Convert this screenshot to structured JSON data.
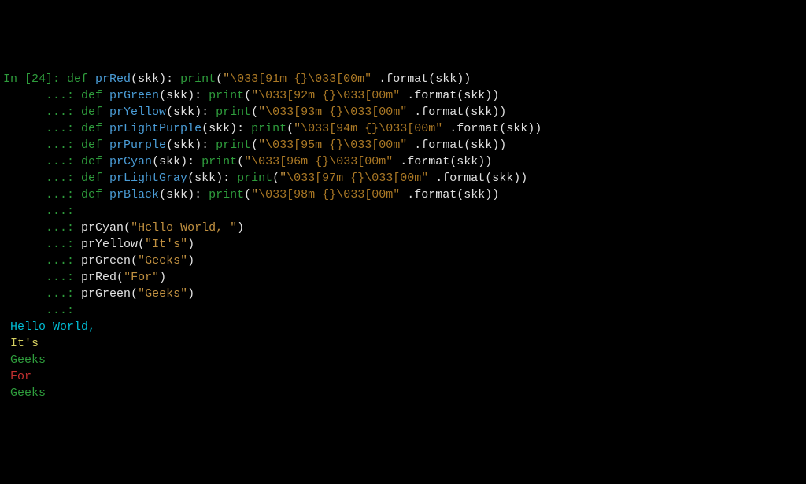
{
  "prompt": {
    "in": "In [24]:",
    "cont": "   ...:"
  },
  "defs": [
    {
      "fn": "prRed",
      "code": "91"
    },
    {
      "fn": "prGreen",
      "code": "92"
    },
    {
      "fn": "prYellow",
      "code": "93"
    },
    {
      "fn": "prLightPurple",
      "code": "94"
    },
    {
      "fn": "prPurple",
      "code": "95"
    },
    {
      "fn": "prCyan",
      "code": "96"
    },
    {
      "fn": "prLightGray",
      "code": "97"
    },
    {
      "fn": "prBlack",
      "code": "98"
    }
  ],
  "kw_def": "def",
  "param": "skk",
  "builtin_print": "print",
  "str_prefix": "\"",
  "esc1a": "\\033[",
  "esc1b": "m {}",
  "esc2": "\\033[00m\"",
  "dot_format": " .format(skk))",
  "colon_space": ": ",
  "close_def": "): ",
  "open_paren": "(",
  "calls": [
    {
      "fn": "prCyan",
      "arg": "\"Hello World, \""
    },
    {
      "fn": "prYellow",
      "arg": "\"It's\""
    },
    {
      "fn": "prGreen",
      "arg": "\"Geeks\""
    },
    {
      "fn": "prRed",
      "arg": "\"For\""
    },
    {
      "fn": "prGreen",
      "arg": "\"Geeks\""
    }
  ],
  "output": [
    {
      "text": " Hello World,",
      "class": "out-cyan"
    },
    {
      "text": " It's",
      "class": "out-yellow"
    },
    {
      "text": " Geeks",
      "class": "out-green"
    },
    {
      "text": " For",
      "class": "out-red"
    },
    {
      "text": " Geeks",
      "class": "out-green"
    }
  ]
}
